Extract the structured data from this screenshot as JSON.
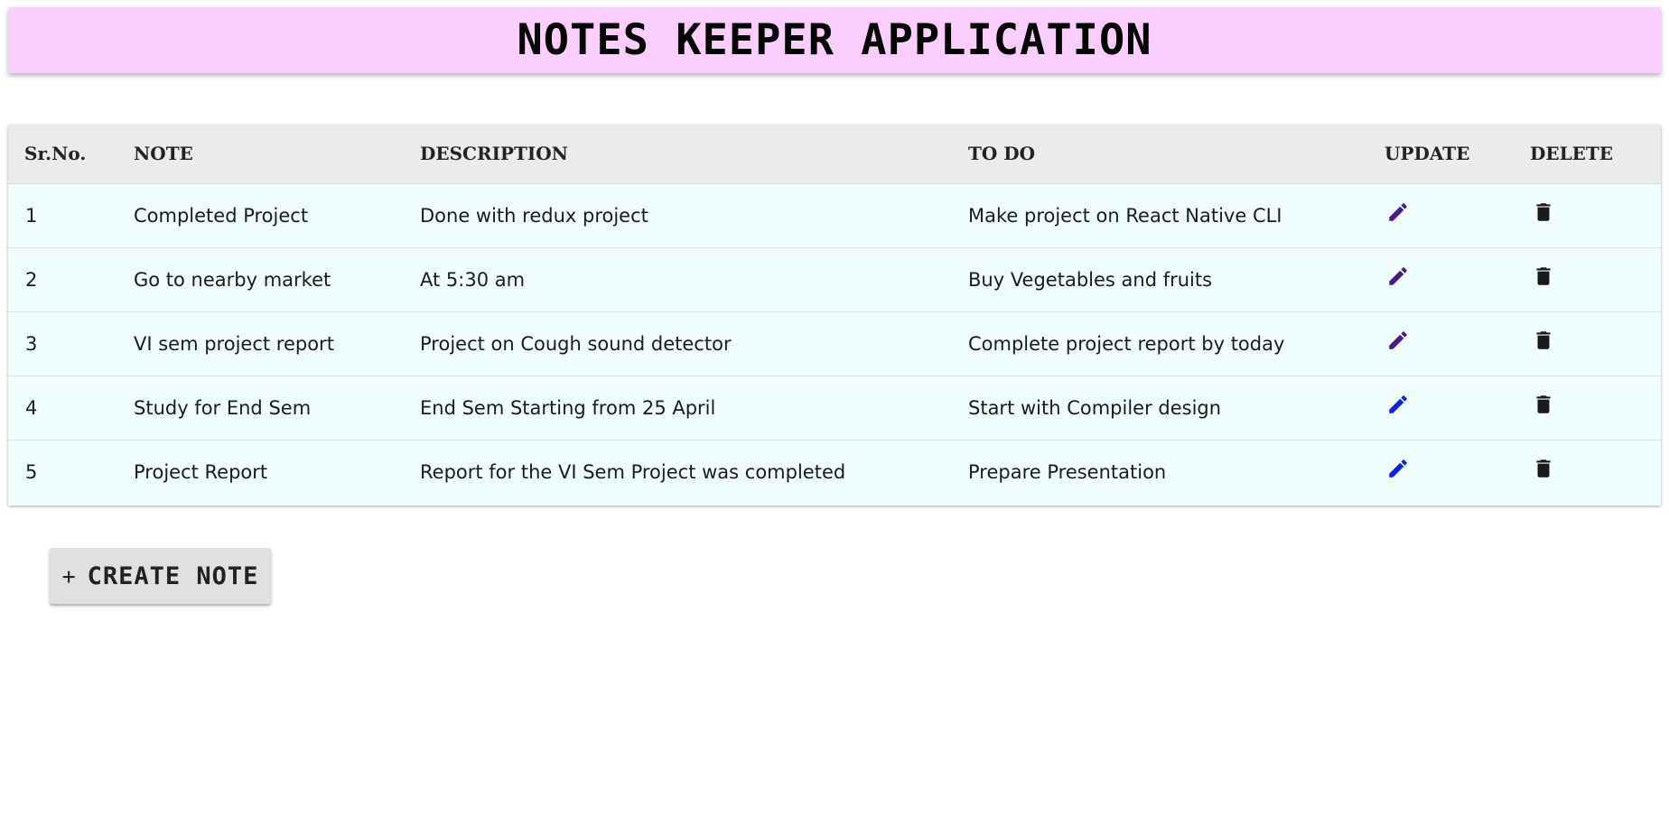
{
  "app": {
    "title": "NOTES KEEPER APPLICATION"
  },
  "table": {
    "headers": {
      "sr": "Sr.No.",
      "note": "NOTE",
      "description": "DESCRIPTION",
      "todo": "TO DO",
      "update": "UPDATE",
      "delete": "DELETE"
    },
    "rows": [
      {
        "sr": "1",
        "note": "Completed Project",
        "description": "Done with redux project",
        "todo": "Make project on React Native CLI",
        "update_icon": "pencil-icon",
        "delete_icon": "trash-icon",
        "update_color": "#4a1a8c"
      },
      {
        "sr": "2",
        "note": "Go to nearby market",
        "description": "At 5:30 am",
        "todo": "Buy Vegetables and fruits",
        "update_icon": "pencil-icon",
        "delete_icon": "trash-icon",
        "update_color": "#4a1a8c"
      },
      {
        "sr": "3",
        "note": "VI sem project report",
        "description": "Project on Cough sound detector",
        "todo": "Complete project report by today",
        "update_icon": "pencil-icon",
        "delete_icon": "trash-icon",
        "update_color": "#4a1a8c"
      },
      {
        "sr": "4",
        "note": "Study for End Sem",
        "description": "End Sem Starting from 25 April",
        "todo": "Start with Compiler design",
        "update_icon": "pencil-icon",
        "delete_icon": "trash-icon",
        "update_color": "#0a1ef5"
      },
      {
        "sr": "5",
        "note": "Project Report",
        "description": "Report for the VI Sem Project was completed",
        "todo": "Prepare Presentation",
        "update_icon": "pencil-icon",
        "delete_icon": "trash-icon",
        "update_color": "#0a1ef5"
      }
    ]
  },
  "actions": {
    "create_plus": "+",
    "create_label": "CREATE NOTE"
  },
  "colors": {
    "header_bg": "#fbcffd",
    "table_header_bg": "#ebebeb",
    "row_bg": "#f0fffe",
    "button_bg": "#e0e0e0",
    "delete_icon": "#1a1a1a"
  }
}
